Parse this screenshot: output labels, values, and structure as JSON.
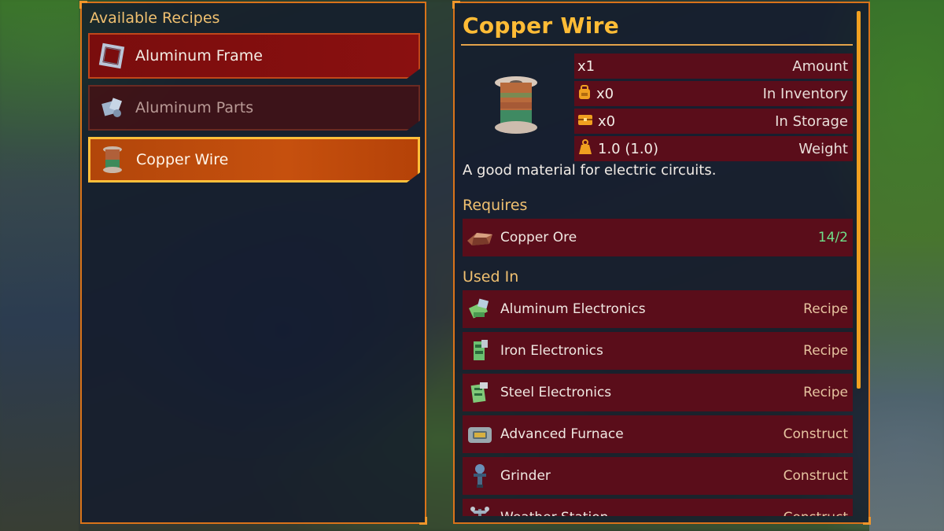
{
  "recipes_panel": {
    "heading": "Available Recipes",
    "items": [
      {
        "label": "Aluminum Frame",
        "icon": "aluminum-frame-icon",
        "state": "available"
      },
      {
        "label": "Aluminum Parts",
        "icon": "aluminum-parts-icon",
        "state": "unavailable"
      },
      {
        "label": "Copper Wire",
        "icon": "copper-wire-icon",
        "state": "selected"
      }
    ]
  },
  "detail": {
    "title": "Copper Wire",
    "stats": [
      {
        "value": "x1",
        "label": "Amount",
        "icon": ""
      },
      {
        "value": "x0",
        "label": "In Inventory",
        "icon": "backpack-icon"
      },
      {
        "value": "x0",
        "label": "In Storage",
        "icon": "chest-icon"
      },
      {
        "value": "1.0 (1.0)",
        "label": "Weight",
        "icon": "weight-icon"
      }
    ],
    "description": "A good material for electric circuits.",
    "requires_heading": "Requires",
    "requires": [
      {
        "name": "Copper Ore",
        "count": "14/2",
        "icon": "copper-ore-icon"
      }
    ],
    "used_in_heading": "Used In",
    "used_in": [
      {
        "name": "Aluminum Electronics",
        "type": "Recipe",
        "icon": "aluminum-electronics-icon"
      },
      {
        "name": "Iron Electronics",
        "type": "Recipe",
        "icon": "iron-electronics-icon"
      },
      {
        "name": "Steel Electronics",
        "type": "Recipe",
        "icon": "steel-electronics-icon"
      },
      {
        "name": "Advanced Furnace",
        "type": "Construct",
        "icon": "advanced-furnace-icon"
      },
      {
        "name": "Grinder",
        "type": "Construct",
        "icon": "grinder-icon"
      },
      {
        "name": "Weather Station",
        "type": "Construct",
        "icon": "weather-station-icon"
      }
    ]
  },
  "colors": {
    "accent": "#ffbc36",
    "panel_border": "#d9731a",
    "row_bg": "#5a0d1a",
    "selected": "#c6500e",
    "count_ok": "#6fe08a"
  }
}
